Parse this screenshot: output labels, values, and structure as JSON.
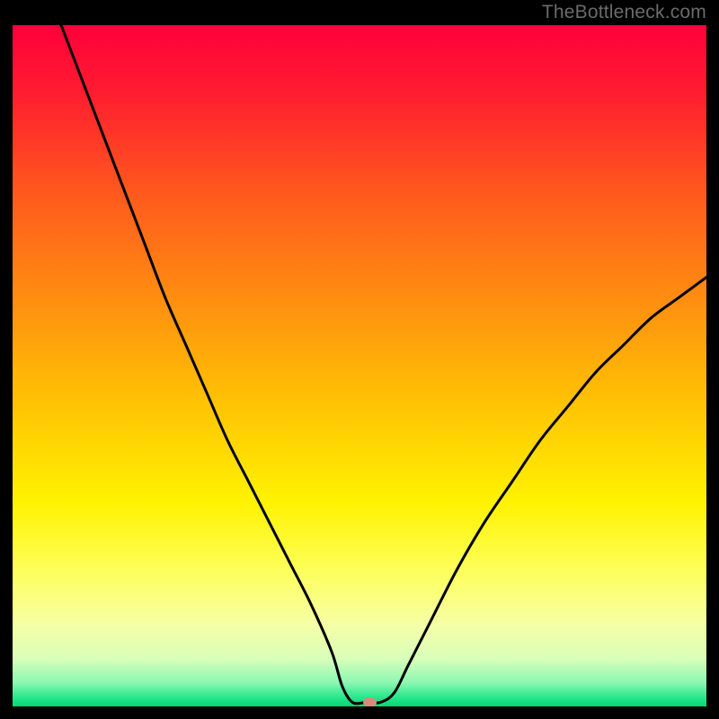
{
  "attribution": "TheBottleneck.com",
  "chart_data": {
    "type": "line",
    "title": "",
    "xlabel": "",
    "ylabel": "",
    "xlim": [
      0,
      100
    ],
    "ylim": [
      0,
      100
    ],
    "grid": false,
    "legend": false,
    "series": [
      {
        "name": "bottleneck-curve",
        "x": [
          7,
          10,
          13,
          16,
          19,
          22,
          25,
          28,
          31,
          34,
          37,
          40,
          43,
          46,
          47.5,
          49,
          51,
          53,
          55,
          57,
          60,
          64,
          68,
          72,
          76,
          80,
          84,
          88,
          92,
          96,
          100
        ],
        "values": [
          100,
          92,
          84,
          76,
          68,
          60,
          53,
          46,
          39,
          33,
          27,
          21,
          15,
          8,
          3,
          0.6,
          0.6,
          0.6,
          2,
          6,
          12,
          20,
          27,
          33,
          39,
          44,
          49,
          53,
          57,
          60,
          63
        ]
      }
    ],
    "background_gradient": {
      "stops": [
        {
          "offset": 0.0,
          "color": "#ff003a"
        },
        {
          "offset": 0.1,
          "color": "#ff1d2f"
        },
        {
          "offset": 0.25,
          "color": "#ff5a1d"
        },
        {
          "offset": 0.4,
          "color": "#ff8d10"
        },
        {
          "offset": 0.55,
          "color": "#ffc104"
        },
        {
          "offset": 0.7,
          "color": "#fff200"
        },
        {
          "offset": 0.8,
          "color": "#fdff5a"
        },
        {
          "offset": 0.88,
          "color": "#f6ffa6"
        },
        {
          "offset": 0.93,
          "color": "#d8ffba"
        },
        {
          "offset": 0.965,
          "color": "#8cf7b2"
        },
        {
          "offset": 0.985,
          "color": "#2fe88f"
        },
        {
          "offset": 1.0,
          "color": "#00d973"
        }
      ]
    },
    "marker": {
      "x": 51.5,
      "y": 0.6,
      "color": "#d88a7a",
      "rx": 7.5,
      "ry": 5.5
    }
  }
}
